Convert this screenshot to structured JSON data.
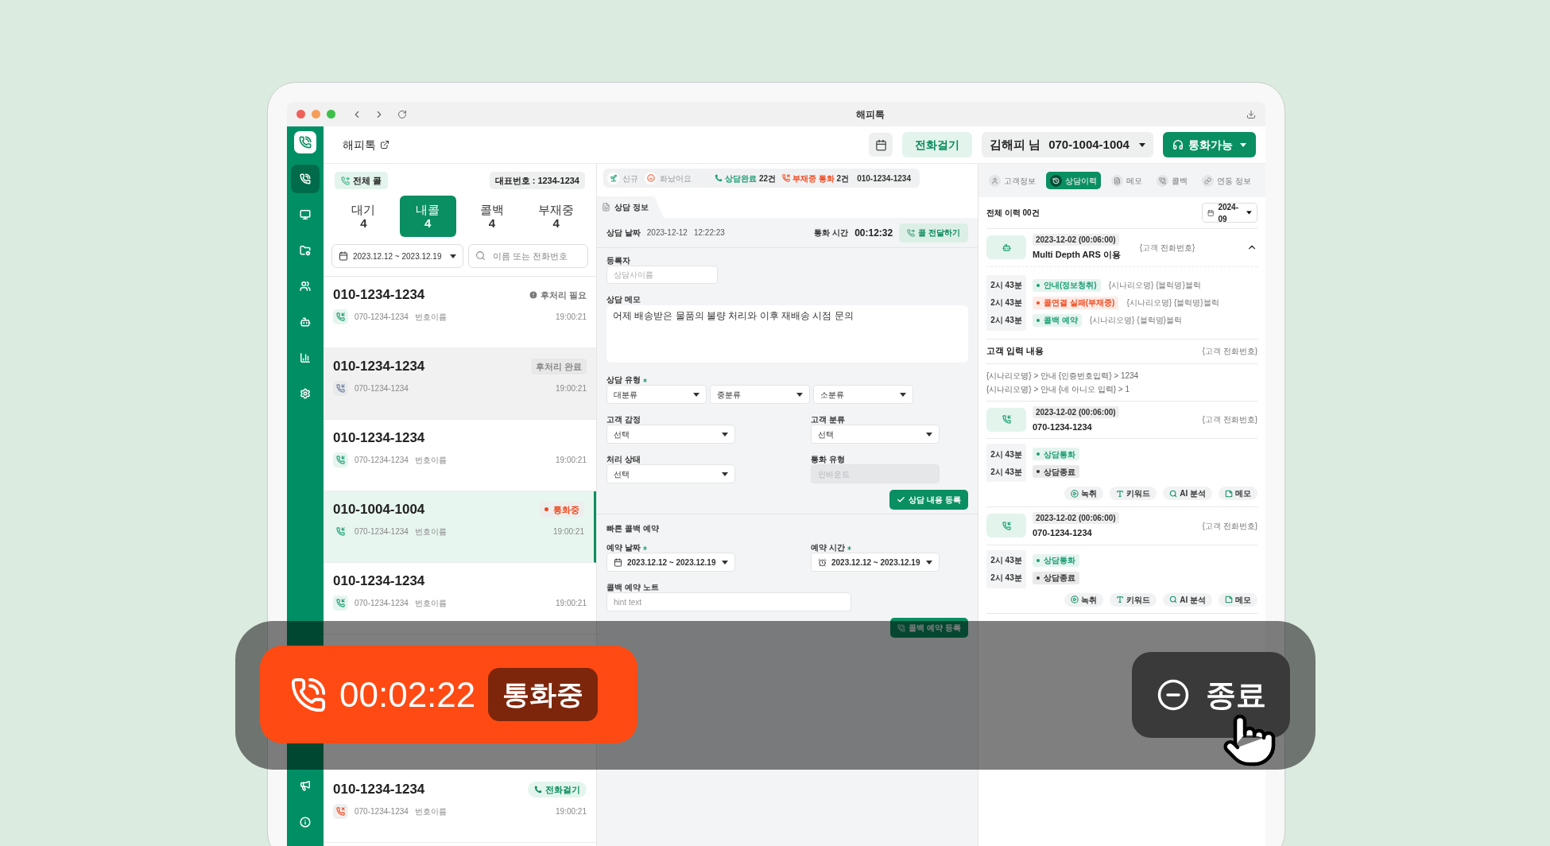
{
  "window": {
    "title": "해피톡"
  },
  "sidebar": {
    "items": [
      {
        "selected": true
      },
      {
        "selected": false
      },
      {
        "selected": false
      },
      {
        "selected": false
      },
      {
        "selected": false
      },
      {
        "selected": false
      },
      {
        "selected": false
      }
    ],
    "bottom_items": [
      {
        "selected": false
      },
      {
        "selected": false
      }
    ]
  },
  "header": {
    "title": "해피톡",
    "call_button": "전화걸기",
    "agent": "김해피 님",
    "agent_number": "070-1004-1004",
    "status": "통화가능"
  },
  "call_list": {
    "filter": "전체 콜",
    "main_number": "대표번호 : 1234-1234",
    "tabs": [
      {
        "label": "대기",
        "count": "4",
        "selected": false
      },
      {
        "label": "내콜",
        "count": "4",
        "selected": true
      },
      {
        "label": "콜백",
        "count": "4",
        "selected": false
      },
      {
        "label": "부재중",
        "count": "4",
        "selected": false
      }
    ],
    "date_range": "2023.12.12 ~ 2023.12.19",
    "search": {
      "placeholder": "이름 또는 전화번호"
    },
    "rows": [
      {
        "phone": "010-1234-1234",
        "line": "070-1234-1234",
        "name": "번호이름",
        "time": "19:00:21",
        "kind": "inbound",
        "badge": {
          "kind": "alert",
          "label": "후처리 필요"
        },
        "selected": false,
        "muted": false
      },
      {
        "phone": "010-1234-1234",
        "line": "070-1234-1234",
        "time": "19:00:21",
        "kind": "done",
        "badge": {
          "kind": "done",
          "label": "후처리 완료"
        },
        "selected": false,
        "muted": true
      },
      {
        "phone": "010-1234-1234",
        "line": "070-1234-1234",
        "name": "번호이름",
        "time": "19:00:21",
        "kind": "inbound",
        "selected": false,
        "muted": false
      },
      {
        "phone": "010-1004-1004",
        "line": "070-1234-1234",
        "name": "번호이름",
        "time": "19:00:21",
        "kind": "inbound",
        "badge": {
          "kind": "live",
          "label": "통화중"
        },
        "selected": true,
        "muted": false
      },
      {
        "phone": "010-1234-1234",
        "line": "070-1234-1234",
        "name": "번호이름",
        "time": "19:00:21",
        "kind": "inbound",
        "selected": false,
        "muted": false
      },
      {
        "phone": "010-1234-1234",
        "line": "070-1234-1234",
        "name": "번호이름",
        "time": "19:00:21",
        "kind": "missed",
        "badge": {
          "kind": "call",
          "label": "전화걸기"
        },
        "selected": false,
        "muted": false
      }
    ]
  },
  "status_strip": {
    "tags": [
      {
        "label": "신규",
        "kind": "new"
      },
      {
        "label": "화났어요",
        "kind": "angry"
      }
    ],
    "completed": "상담완료",
    "completed_count": "22건",
    "missed": "부재중 통화",
    "missed_count": "2건",
    "phone": "010-1234-1234"
  },
  "consult": {
    "tab": "상담 정보",
    "date_label": "상담 날짜",
    "date": "2023-12-12",
    "time": "12:22:23",
    "duration_label": "통화 시간",
    "duration": "00:12:32",
    "transfer_button": "콜 전달하기",
    "registrant": {
      "label": "등록자",
      "placeholder": "상담사이름"
    },
    "memo": {
      "label": "상담 메모",
      "value": "어제 배송받은 물품의 불량 처리와 이후 재배송 시점 문의"
    },
    "type": {
      "label": "상담 유형",
      "required": true,
      "selects": [
        "대분류",
        "중분류",
        "소분류"
      ]
    },
    "fields": [
      {
        "label": "고객 감정",
        "value": "선택",
        "disabled": false
      },
      {
        "label": "고객 분류",
        "value": "선택",
        "disabled": false
      },
      {
        "label": "처리 상태",
        "value": "선택",
        "disabled": false
      },
      {
        "label": "통화 유형",
        "value": "인바운드",
        "disabled": true
      }
    ],
    "submit": "상담 내용 등록"
  },
  "callback": {
    "title": "빠른 콜백 예약",
    "date": {
      "label": "예약 날짜",
      "required": true,
      "value": "2023.12.12 ~ 2023.12.19"
    },
    "time": {
      "label": "예약 시간",
      "required": true,
      "value": "2023.12.12 ~ 2023.12.19"
    },
    "note": {
      "label": "콜백 예약 노트",
      "placeholder": "hint text"
    },
    "submit": "콜백 예약 등록"
  },
  "history": {
    "tabs": [
      {
        "label": "고객정보",
        "selected": false
      },
      {
        "label": "상담이력",
        "selected": true
      },
      {
        "label": "메모",
        "selected": false
      },
      {
        "label": "콜백",
        "selected": false
      },
      {
        "label": "연동 정보",
        "selected": false
      }
    ],
    "total": "전체 이력 00건",
    "month": "2024-09",
    "entries": [
      {
        "kind": "ars",
        "datetime": "2023-12-02 (00:06:00)",
        "title": "Multi Depth ARS 이용",
        "caller": "{고객 전화번호}",
        "expanded": true,
        "events": [
          {
            "time": "2시 43분",
            "label": "안내(정보청취)",
            "color": "#1a9e73",
            "detail": "{시나리오명} {블럭명}블럭"
          },
          {
            "time": "2시 43분",
            "label": "콜연결 실패(부재중)",
            "color": "#f04a1f",
            "detail": "{시나리오명} {블럭명}블럭"
          },
          {
            "time": "2시 43분",
            "label": "콜백 예약",
            "color": "#1a9e73",
            "detail": "{시나리오명} {블럭명}블럭"
          }
        ],
        "inputs": {
          "title": "고객 입력 내용",
          "caller": "{고객 전화번호}",
          "lines": [
            "{시나리오명} > 안내 {인증번호입력} > 1234",
            "{시나리오명} > 안내 {네 아니오 입력} > 1"
          ]
        }
      },
      {
        "kind": "call",
        "datetime": "2023-12-02 (00:06:00)",
        "title": "070-1234-1234",
        "caller": "{고객 전화번호}",
        "expanded": false,
        "events": [
          {
            "time": "2시 43분",
            "label": "상담통화",
            "color": "#1a9e73"
          },
          {
            "time": "2시 43분",
            "label": "상담종료",
            "color": "#333333"
          }
        ],
        "actions": [
          {
            "kind": "record",
            "label": "녹취"
          },
          {
            "kind": "keyword",
            "label": "키워드"
          },
          {
            "kind": "ai",
            "label": "AI 분석"
          },
          {
            "kind": "memo",
            "label": "메모"
          }
        ]
      },
      {
        "kind": "call",
        "datetime": "2023-12-02 (00:06:00)",
        "title": "070-1234-1234",
        "caller": "{고객 전화번호}",
        "expanded": false,
        "events": [
          {
            "time": "2시 43분",
            "label": "상담통화",
            "color": "#1a9e73"
          },
          {
            "time": "2시 43분",
            "label": "상담종료",
            "color": "#333333"
          }
        ],
        "actions": [
          {
            "kind": "record",
            "label": "녹취"
          },
          {
            "kind": "keyword",
            "label": "키워드"
          },
          {
            "kind": "ai",
            "label": "AI 분석"
          },
          {
            "kind": "memo",
            "label": "메모"
          }
        ]
      }
    ]
  },
  "call_bar": {
    "timer": "00:02:22",
    "status": "통화중",
    "end_button": "종료"
  }
}
